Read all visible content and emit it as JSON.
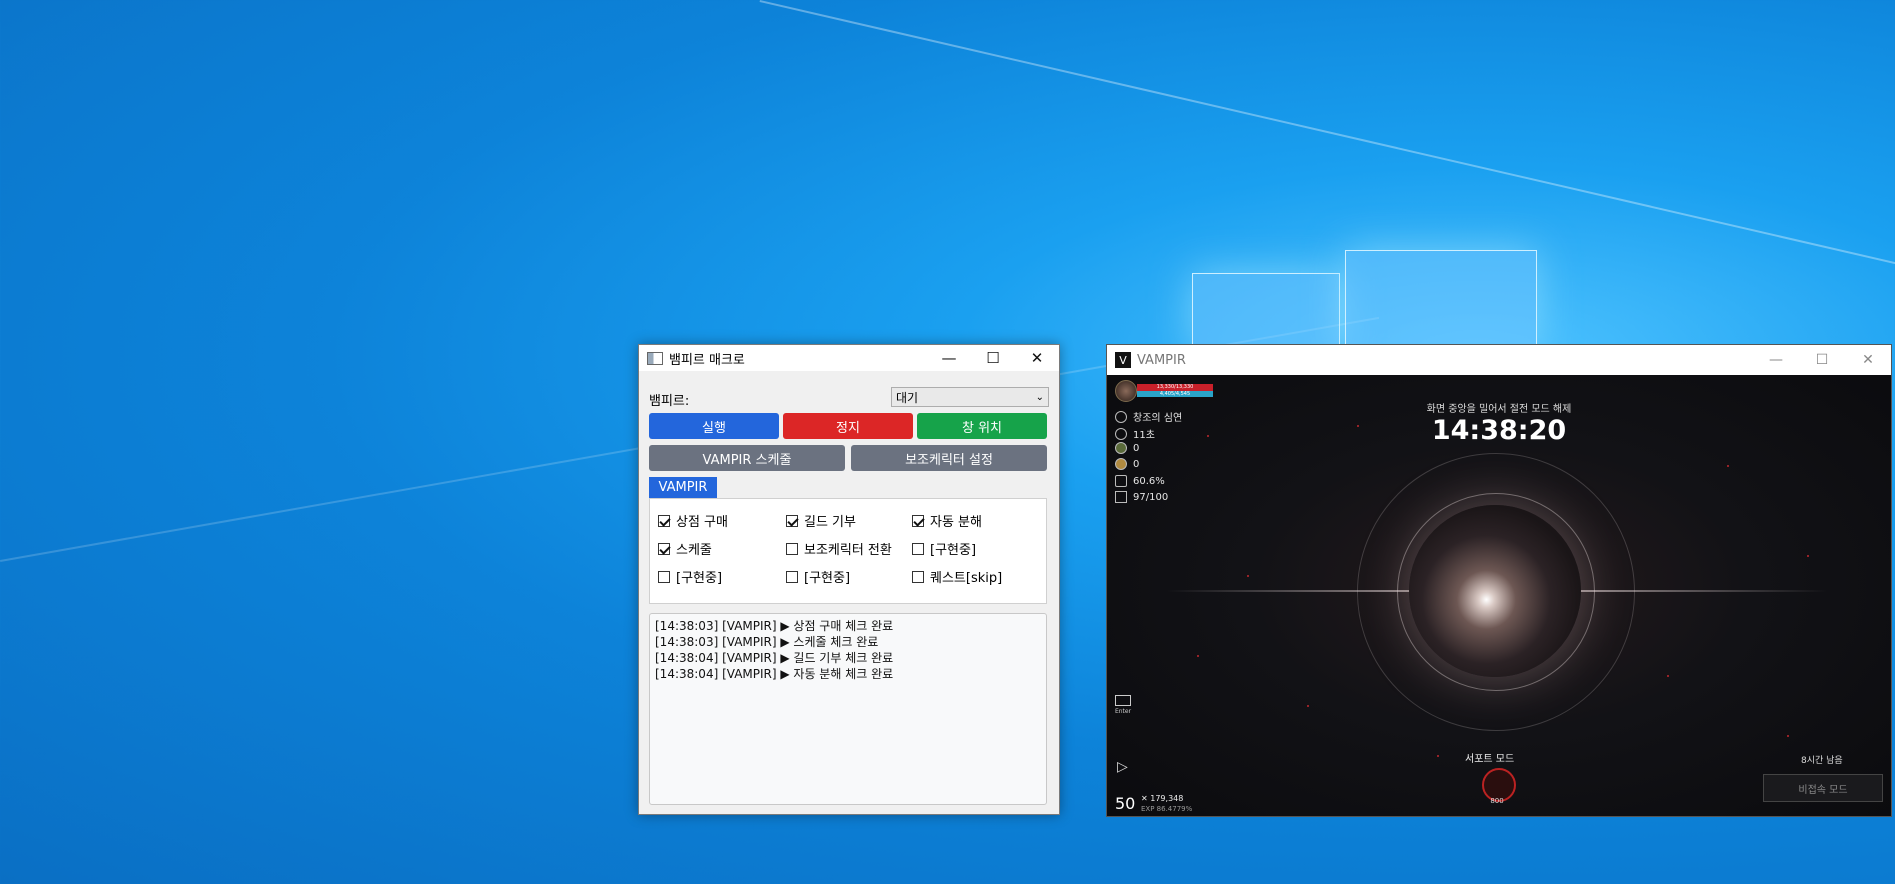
{
  "desktop": {
    "colors": {
      "bg": "#0d83d9",
      "light": "#4fc3ff"
    }
  },
  "macro": {
    "title": "뱀피르 매크로",
    "window_buttons": {
      "minimize": "—",
      "maximize": "☐",
      "close": "✕"
    },
    "profile_label": "뱀피르:",
    "profile_value": "대기",
    "buttons": {
      "run": "실행",
      "stop": "정지",
      "window_pos": "창 위치",
      "schedule": "VAMPIR 스케줄",
      "sub_char": "보조케릭터 설정"
    },
    "tab": "VAMPIR",
    "checkboxes": [
      {
        "label": "상점 구매",
        "checked": true
      },
      {
        "label": "길드 기부",
        "checked": true
      },
      {
        "label": "자동 분해",
        "checked": true
      },
      {
        "label": "스케줄",
        "checked": true
      },
      {
        "label": "보조케릭터 전환",
        "checked": false
      },
      {
        "label": "[구현중]",
        "checked": false
      },
      {
        "label": "[구현중]",
        "checked": false
      },
      {
        "label": "[구현중]",
        "checked": false
      },
      {
        "label": "퀘스트[skip]",
        "checked": false
      }
    ],
    "log": [
      "[14:38:03] [VAMPIR] ▶ 상점 구매 체크 완료",
      "[14:38:03] [VAMPIR] ▶ 스케줄 체크 완료",
      "[14:38:04] [VAMPIR] ▶ 길드 기부 체크 완료",
      "[14:38:04] [VAMPIR] ▶ 자동 분해 체크 완료"
    ],
    "colors": {
      "run": "#2366dc",
      "stop": "#dc2626",
      "pos": "#16a34a",
      "gray": "#6b7280"
    }
  },
  "game": {
    "title": "VAMPIR",
    "icon_letter": "V",
    "hp_text": "13,330/13,330",
    "mp_text": "4,405/4,545",
    "location": "창조의 심연",
    "time_elapsed": "11초",
    "currency1": "0",
    "currency2": "0",
    "weight": "60.6%",
    "inventory": "97/100",
    "notice": "화면 중앙을 밀어서 절전 모드 해제",
    "clock": "14:38:20",
    "support_mode": "서포트 모드",
    "support_value": "800",
    "remaining": "8시간 남음",
    "offline_mode": "비접속 모드",
    "enter_key": "Enter",
    "level": "50",
    "gold": "179,348",
    "exp": "EXP 86.4779%"
  }
}
